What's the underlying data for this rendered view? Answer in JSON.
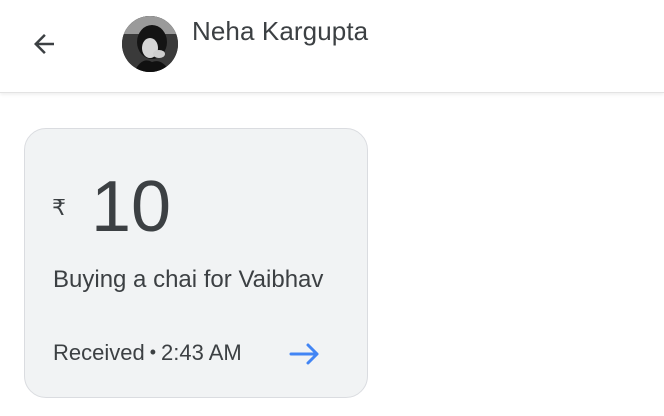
{
  "header": {
    "back_icon": "arrow-back-icon",
    "contact_name": "Neha Kargupta",
    "avatar_icon": "profile-photo"
  },
  "payment": {
    "currency_symbol": "₹",
    "amount": "10",
    "note": "Buying a chai for Vaibhav",
    "status": "Received",
    "separator": "•",
    "time": "2:43 AM",
    "arrow_icon": "arrow-forward-icon"
  },
  "colors": {
    "text": "#3c4043",
    "card_background": "#f1f3f4",
    "card_border": "#dadce0",
    "accent": "#4285f4"
  }
}
